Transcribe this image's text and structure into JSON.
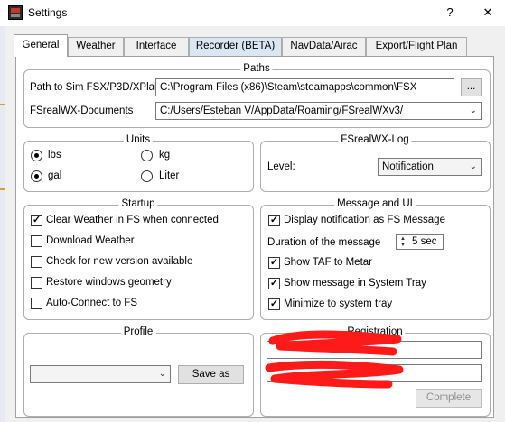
{
  "window": {
    "title": "Settings",
    "help_label": "?",
    "close_label": "✕"
  },
  "tabs": [
    {
      "label": "General",
      "active": true
    },
    {
      "label": "Weather"
    },
    {
      "label": "Interface"
    },
    {
      "label": "Recorder (BETA)"
    },
    {
      "label": "NavData/Airac"
    },
    {
      "label": "Export/Flight Plan"
    }
  ],
  "paths": {
    "title": "Paths",
    "sim_label": "Path to Sim FSX/P3D/XPlane",
    "sim_value": "C:\\Program Files (x86)\\Steam\\steamapps\\common\\FSX",
    "browse_label": "...",
    "docs_label": "FSrealWX-Documents",
    "docs_value": "C:/Users/Esteban V/AppData/Roaming/FSrealWXv3/"
  },
  "units": {
    "title": "Units",
    "lbs": "lbs",
    "kg": "kg",
    "gal": "gal",
    "liter": "Liter"
  },
  "log": {
    "title": "FSrealWX-Log",
    "level_label": "Level:",
    "level_value": "Notification"
  },
  "startup": {
    "title": "Startup",
    "items": [
      {
        "label": "Clear Weather in FS when connected",
        "checked": true
      },
      {
        "label": "Download Weather",
        "checked": false
      },
      {
        "label": "Check for new version available",
        "checked": false
      },
      {
        "label": "Restore windows geometry",
        "checked": false
      },
      {
        "label": "Auto-Connect to FS",
        "checked": false
      }
    ]
  },
  "message": {
    "title": "Message and UI",
    "display_notification": "Display notification as FS Message",
    "duration_label": "Duration of the message",
    "duration_value": "5 sec",
    "show_taf": "Show TAF to Metar",
    "show_tray": "Show message in System Tray",
    "minimize_tray": "Minimize to system tray"
  },
  "profile": {
    "title": "Profile",
    "selected": "",
    "save_label": "Save as"
  },
  "registration": {
    "title": "Registration",
    "field1": "",
    "field2": "",
    "complete_label": "Complete"
  },
  "colors": {
    "accent": "#0078d7",
    "redaction": "#ff1a1a",
    "tab_active_bg": "#ffffff",
    "tab_beta_bg": "#dbe6f3"
  }
}
